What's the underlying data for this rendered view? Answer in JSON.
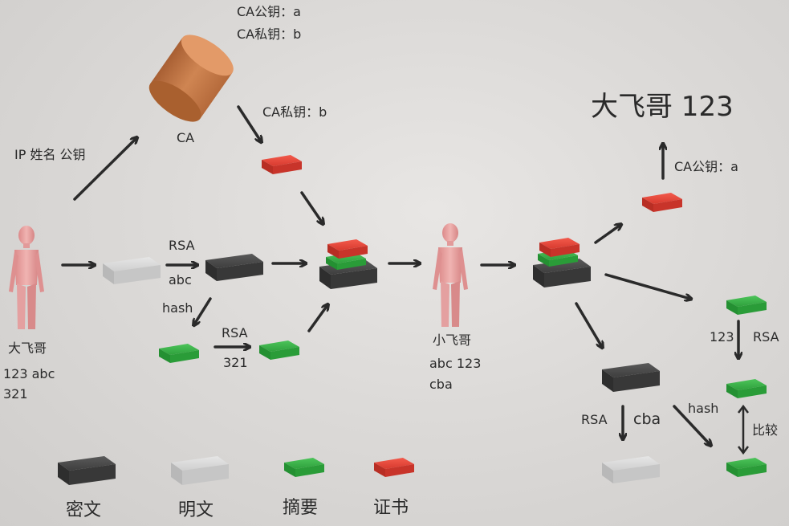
{
  "ca": {
    "public_key": "CA公钥：a",
    "private_key": "CA私钥：b",
    "label": "CA",
    "private_key_sign": "CA私钥：b"
  },
  "left": {
    "ip_info": "IP 姓名 公钥",
    "sender_name": "大飞哥",
    "sender_line1": "123  abc",
    "sender_line2": "321",
    "rsa_top": "RSA",
    "abc": "abc",
    "hash": "hash",
    "rsa_bottom": "RSA",
    "n321": "321"
  },
  "middle": {
    "receiver_name": "小飞哥",
    "receiver_line1": "abc 123",
    "receiver_line2": "cba"
  },
  "right": {
    "result": "大飞哥 123",
    "ca_public": "CA公钥：a",
    "n123": "123",
    "rsa": "RSA",
    "compare": "比较",
    "rsa_bottom": "RSA",
    "cba": "cba",
    "hash": "hash"
  },
  "legend": {
    "ciphertext": "密文",
    "plaintext": "明文",
    "digest": "摘要",
    "certificate": "证书"
  },
  "colors": {
    "cipher": "#4a4a4a",
    "plain": "#d4d4d4",
    "digest": "#3cb04a",
    "cert": "#e8473a",
    "ca_cylinder": "#c47a4a",
    "person": "#e8a0a0",
    "arrow": "#2a2a2a"
  }
}
